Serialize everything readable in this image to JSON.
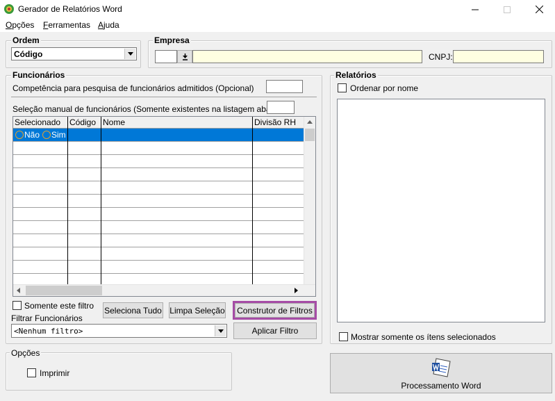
{
  "window": {
    "title": "Gerador de Relatórios Word"
  },
  "menu": [
    {
      "label": "Opções",
      "underline": "O",
      "rest": "pções"
    },
    {
      "label": "Ferramentas",
      "underline": "F",
      "rest": "erramentas"
    },
    {
      "label": "Ajuda",
      "underline": "A",
      "rest": "juda"
    }
  ],
  "ordem": {
    "title": "Ordem",
    "selected": "Código"
  },
  "empresa": {
    "title": "Empresa",
    "code": "",
    "name": "",
    "cnpj_label": "CNPJ:",
    "cnpj": ""
  },
  "funcionarios": {
    "title": "Funcionários",
    "competencia_label": "Competência para pesquisa de funcionários admitidos (Opcional)",
    "competencia_value": "",
    "selecao_label": "Seleção manual de funcionários (Somente existentes na listagem abaixo) ...",
    "selecao_value": "",
    "columns": [
      "Selecionado",
      "Código",
      "Nome",
      "Divisão RH"
    ],
    "first_row": {
      "nao": "Não",
      "sim": "Sim"
    },
    "somente_filtro": "Somente este filtro",
    "seleciona_tudo": "Seleciona Tudo",
    "limpa_selecao": "Limpa Seleção",
    "construtor": "Construtor de Filtros",
    "filtrar_label": "Filtrar Funcionários",
    "filtro_selected": "<Nenhum filtro>",
    "aplicar": "Aplicar Filtro"
  },
  "relatorios": {
    "title": "Relatórios",
    "ordenar": "Ordenar por nome",
    "mostrar": "Mostrar somente os ítens selecionados"
  },
  "opcoes": {
    "title": "Opções",
    "imprimir": "Imprimir"
  },
  "processamento": {
    "label": "Processamento Word"
  },
  "colors": {
    "selection": "#0078d7",
    "highlight_border": "#a64ca6",
    "yellow_field": "#ffffe1"
  }
}
